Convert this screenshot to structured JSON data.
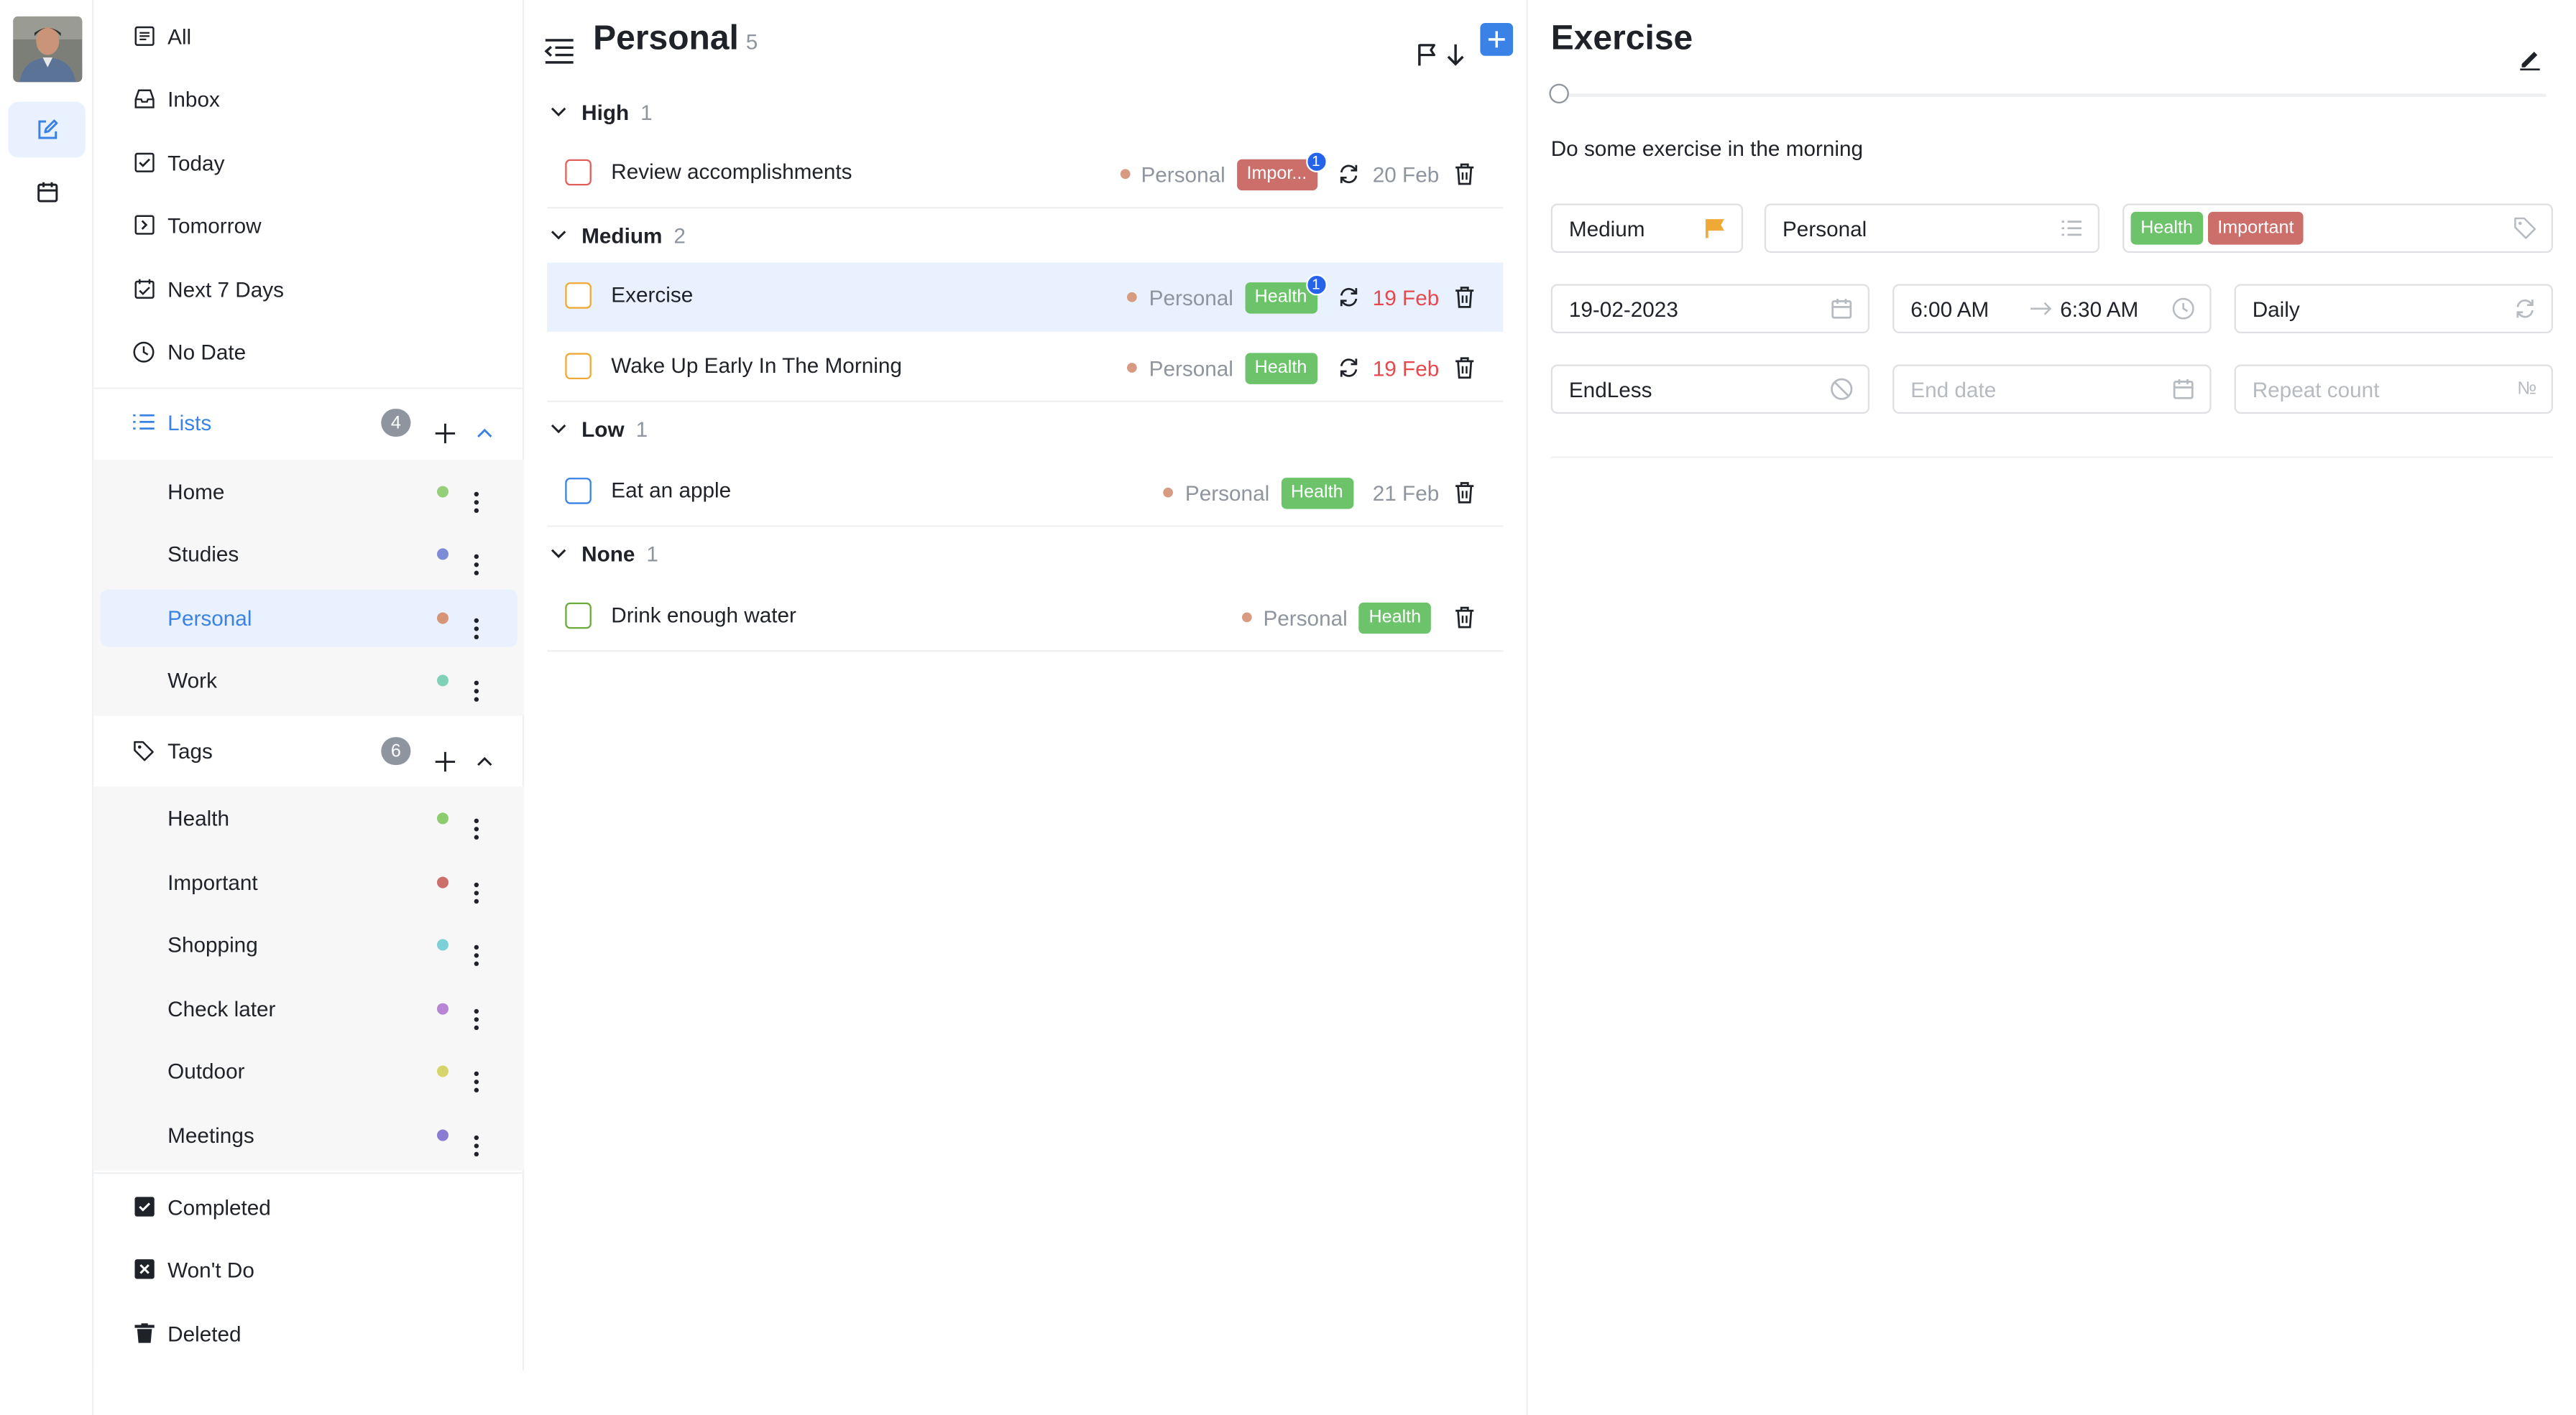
{
  "colors": {
    "accent": "#3b82e6",
    "high": "#e0605a",
    "medium": "#f0a936",
    "low": "#3b82e6",
    "none": "#6aaa3a",
    "health_tag": "#6cc36a",
    "important_tag": "#cc6e6a",
    "overdue": "#e5484d"
  },
  "nav": {
    "all": "All",
    "inbox": "Inbox",
    "today": "Today",
    "tomorrow": "Tomorrow",
    "next7": "Next 7 Days",
    "nodate": "No Date",
    "completed": "Completed",
    "wontdo": "Won't Do",
    "deleted": "Deleted"
  },
  "lists": {
    "label": "Lists",
    "count": "4",
    "items": [
      {
        "label": "Home",
        "color": "#95cf7a"
      },
      {
        "label": "Studies",
        "color": "#7d8cd6"
      },
      {
        "label": "Personal",
        "color": "#d89477"
      },
      {
        "label": "Work",
        "color": "#7fd1b8"
      }
    ]
  },
  "tags": {
    "label": "Tags",
    "count": "6",
    "items": [
      {
        "label": "Health",
        "color": "#8ccc6c"
      },
      {
        "label": "Important",
        "color": "#cc6e6a"
      },
      {
        "label": "Shopping",
        "color": "#7cd0d8"
      },
      {
        "label": "Check later",
        "color": "#b784d6"
      },
      {
        "label": "Outdoor",
        "color": "#d6d46a"
      },
      {
        "label": "Meetings",
        "color": "#8a7cd2"
      }
    ]
  },
  "middle": {
    "title": "Personal",
    "count": "5",
    "groups": [
      {
        "name": "High",
        "count": "1"
      },
      {
        "name": "Medium",
        "count": "2"
      },
      {
        "name": "Low",
        "count": "1"
      },
      {
        "name": "None",
        "count": "1"
      }
    ],
    "tasks": [
      {
        "title": "Review accomplishments",
        "list": "Personal",
        "tag": "Impor...",
        "tag_badge": "1",
        "date": "20 Feb"
      },
      {
        "title": "Exercise",
        "list": "Personal",
        "tag": "Health",
        "tag_badge": "1",
        "date": "19 Feb"
      },
      {
        "title": "Wake Up Early In The Morning",
        "list": "Personal",
        "tag": "Health",
        "date": "19 Feb"
      },
      {
        "title": "Eat an apple",
        "list": "Personal",
        "tag": "Health",
        "date": "21 Feb"
      },
      {
        "title": "Drink enough water",
        "list": "Personal",
        "tag": "Health"
      }
    ]
  },
  "detail": {
    "title": "Exercise",
    "progress": 0,
    "description": "Do some exercise in the morning",
    "priority": "Medium",
    "list": "Personal",
    "tags": [
      "Health",
      "Important"
    ],
    "date": "19-02-2023",
    "start_time": "6:00 AM",
    "end_time": "6:30 AM",
    "repeat": "Daily",
    "end_type": "EndLess",
    "end_date_placeholder": "End date",
    "repeat_count_placeholder": "Repeat count",
    "count_symbol": "№"
  }
}
